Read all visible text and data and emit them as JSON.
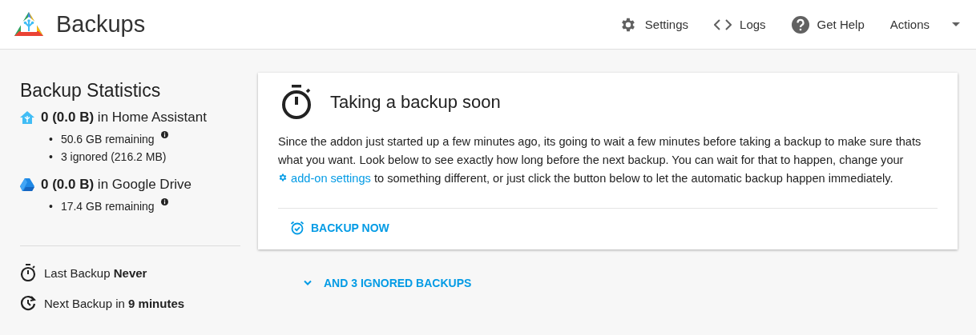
{
  "header": {
    "title": "Backups",
    "nav": [
      {
        "kind": "settings",
        "label": "Settings"
      },
      {
        "kind": "logs",
        "label": "Logs"
      },
      {
        "kind": "help",
        "label": "Get Help"
      }
    ],
    "actions": {
      "label": "Actions"
    }
  },
  "stats": {
    "title": "Backup Statistics",
    "sources": [
      {
        "kind": "home",
        "summary": "**0 (0.0 B)** in Home Assistant",
        "details": [
          {
            "bullet": "•",
            "text": "50.6 GB remaining",
            "has_info": true
          },
          {
            "bullet": "•",
            "text": "3 ignored (216.2 MB)",
            "has_info": false
          }
        ]
      },
      {
        "kind": "drive",
        "summary": "**0 (0.0 B)** in Google Drive",
        "details": [
          {
            "bullet": "•",
            "text": "17.4 GB remaining",
            "has_info": true
          }
        ]
      }
    ],
    "schedule": [
      {
        "kind": "last",
        "text": "Last Backup **Never**"
      },
      {
        "kind": "next",
        "text": "Next Backup in **9 minutes**"
      }
    ]
  },
  "card": {
    "title": "Taking a backup soon",
    "body_before": "Since the addon just started up a few minutes ago, its going to wait a few minutes before taking a backup to make sure thats what you want. Look below to see exactly how long before the next backup. You can wait for that to happen, change your",
    "link": "add-on settings",
    "body_after": "to something different, or just click the button below to let the automatic backup happen immediately.",
    "button": "BACKUP NOW"
  },
  "ignored": {
    "label": "AND 3 IGNORED BACKUPS",
    "expanded": false
  }
}
